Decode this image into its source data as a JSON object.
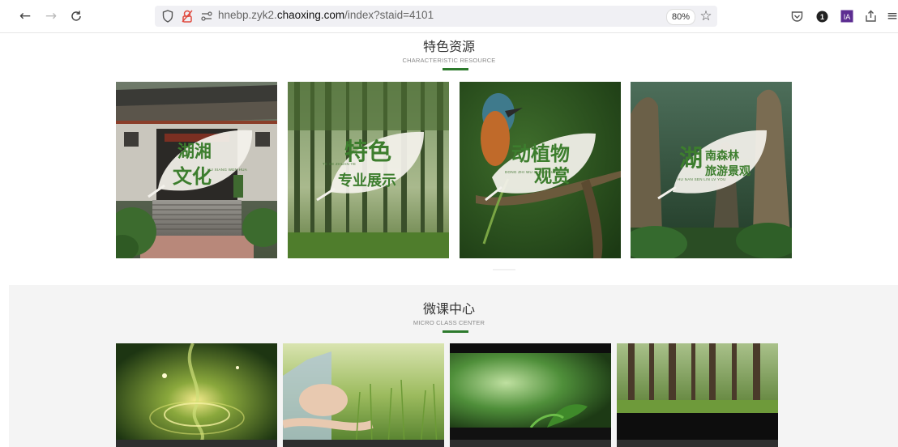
{
  "browser": {
    "url_prefix": "hnebp.zyk2.",
    "url_domain": "chaoxing.com",
    "url_path": "/index?staid=4101",
    "zoom": "80%",
    "icons": [
      "back-icon",
      "forward-icon",
      "reload-icon",
      "shield-icon",
      "permissions-icon",
      "tracking-icon",
      "star-icon",
      "pocket-icon",
      "extension-1-icon",
      "extension-ia-icon",
      "share-icon",
      "menu-icon"
    ]
  },
  "featured": {
    "title": "特色资源",
    "subtitle": "CHARACTERISTIC RESOURCE",
    "accent": "#2d7a2d",
    "items": [
      {
        "line1": "湖湘",
        "line2": "文化",
        "small": "HU XIANG WEN HUA"
      },
      {
        "line1": "特色",
        "line2": "专业展示",
        "small": "TE SE ZHUAN YE"
      },
      {
        "line1": "动植物",
        "line2": "观赏",
        "small": "DONG ZHI WU GUAN SHANG"
      },
      {
        "line1": "湖",
        "line1b": "南森林",
        "line2": "旅游景观",
        "small": "HU NAN SEN LIN LV YOU"
      }
    ]
  },
  "micro": {
    "title": "微课中心",
    "subtitle": "MICRO CLASS CENTER",
    "courses": [
      "course-forest-spirit",
      "course-yoga-grass",
      "course-green-seedling",
      "course-tall-trees"
    ]
  }
}
